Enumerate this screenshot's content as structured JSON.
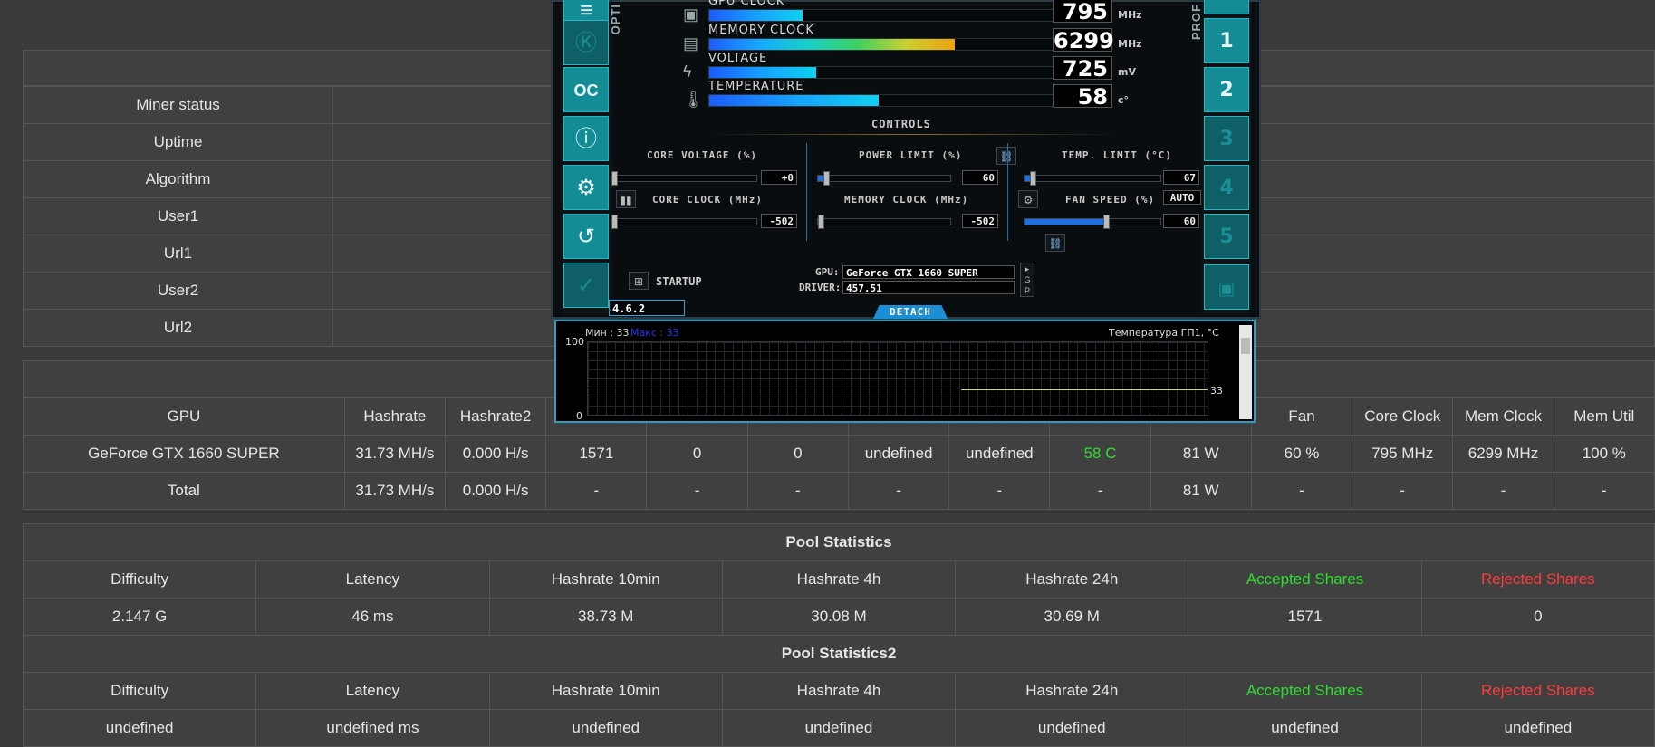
{
  "summary_rows": [
    {
      "label": "Miner status"
    },
    {
      "label": "Uptime"
    },
    {
      "label": "Algorithm"
    },
    {
      "label": "User1"
    },
    {
      "label": "Url1"
    },
    {
      "label": "User2"
    },
    {
      "label": "Url2"
    }
  ],
  "gpu_table": {
    "headers": [
      "GPU",
      "Hashrate",
      "Hashrate2",
      "",
      "",
      "",
      "",
      "",
      "",
      "",
      "Fan",
      "Core Clock",
      "Mem Clock",
      "Mem Util"
    ],
    "rows": [
      [
        "GeForce GTX 1660 SUPER",
        "31.73 MH/s",
        "0.000 H/s",
        "1571",
        "0",
        "0",
        "undefined",
        "undefined",
        "58 C",
        "81 W",
        "60 %",
        "795 MHz",
        "6299 MHz",
        "100 %"
      ],
      [
        "Total",
        "31.73 MH/s",
        "0.000 H/s",
        "-",
        "-",
        "-",
        "-",
        "-",
        "-",
        "81 W",
        "-",
        "-",
        "-",
        "-"
      ]
    ]
  },
  "pool1": {
    "title": "Pool Statistics",
    "headers": [
      "Difficulty",
      "Latency",
      "Hashrate 10min",
      "Hashrate 4h",
      "Hashrate 24h",
      "Accepted Shares",
      "Rejected Shares"
    ],
    "values": [
      "2.147 G",
      "46 ms",
      "38.73 M",
      "30.08 M",
      "30.69 M",
      "1571",
      "0"
    ]
  },
  "pool2": {
    "title": "Pool Statistics2",
    "headers": [
      "Difficulty",
      "Latency",
      "Hashrate 10min",
      "Hashrate 4h",
      "Hashrate 24h",
      "Accepted Shares",
      "Rejected Shares"
    ],
    "values": [
      "undefined",
      "undefined ms",
      "undefined",
      "undefined",
      "undefined",
      "undefined",
      "undefined"
    ]
  },
  "afterburner": {
    "meters": [
      {
        "label": "GPU CLOCK",
        "value": "795",
        "unit": "MHz",
        "fill": 0.27
      },
      {
        "label": "MEMORY CLOCK",
        "value": "6299",
        "unit": "MHz",
        "fill": 0.71
      },
      {
        "label": "VOLTAGE",
        "value": "725",
        "unit": "mV",
        "fill": 0.31
      },
      {
        "label": "TEMPERATURE",
        "value": "58",
        "unit": "c°",
        "fill": 0.49
      }
    ],
    "controls_title": "CONTROLS",
    "core_voltage": {
      "label": "CORE VOLTAGE (%)",
      "value": "+0"
    },
    "power_limit": {
      "label": "POWER LIMIT (%)",
      "value": "60"
    },
    "temp_limit": {
      "label": "TEMP. LIMIT (°C)",
      "value": "67"
    },
    "core_clock": {
      "label": "CORE CLOCK (MHz)",
      "value": "-502"
    },
    "memory_clock": {
      "label": "MEMORY CLOCK (MHz)",
      "value": "-502"
    },
    "fan_speed": {
      "label": "FAN SPEED (%)",
      "value": "60",
      "auto": "AUTO",
      "level": 0.6
    },
    "startup": "STARTUP",
    "gpu_label": "GPU:",
    "gpu_name": "GeForce GTX 1660 SUPER",
    "driver_label": "DRIVER:",
    "driver": "457.51",
    "detach": "DETACH",
    "version": "4.6.2",
    "left_vertical": "OPTI",
    "right_vertical": "PROF",
    "profiles": [
      "1",
      "2",
      "3",
      "4",
      "5"
    ]
  },
  "monitor": {
    "min_label": "Мин : 33",
    "max_label": "Макс : 33",
    "title": "Температура ГП1, °C",
    "y_top": "100",
    "y_bottom": "0",
    "current": "33"
  }
}
